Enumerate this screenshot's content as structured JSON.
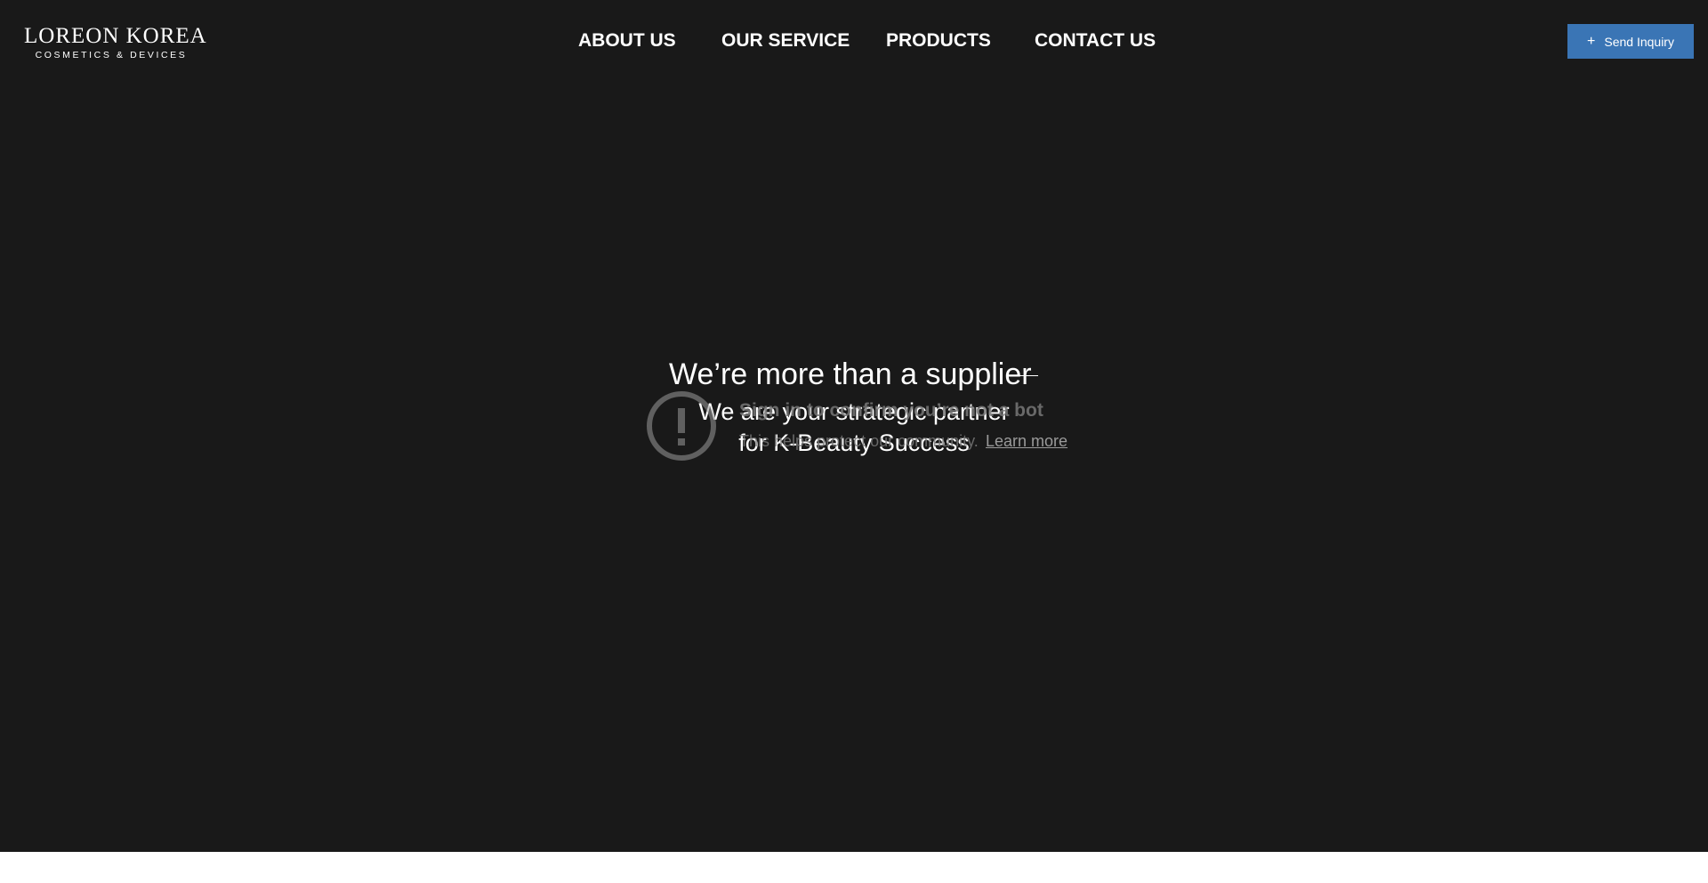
{
  "header": {
    "logo": {
      "name": "LOREON KOREA",
      "tagline": "COSMETICS & DEVICES"
    },
    "nav": [
      {
        "label": "ABOUT US"
      },
      {
        "label": "OUR SERVICE"
      },
      {
        "label": "PRODUCTS"
      },
      {
        "label": "CONTACT US"
      }
    ],
    "inquiry_button": {
      "icon": "plus-icon",
      "label": "Send Inquiry",
      "color": "#3a75b5"
    }
  },
  "hero": {
    "title": "We’re more than a supplier",
    "subtitle_line1": "We are your strategic partner",
    "subtitle_line2": "for K-Beauty Success"
  },
  "bot_check": {
    "icon": "alert-circle-icon",
    "heading": "Sign in to confirm you’re not a bot",
    "text": "This helps protect our community.",
    "link": "Learn more"
  },
  "colors": {
    "background": "#191919",
    "text": "#ffffff",
    "accent": "#3a75b5"
  }
}
